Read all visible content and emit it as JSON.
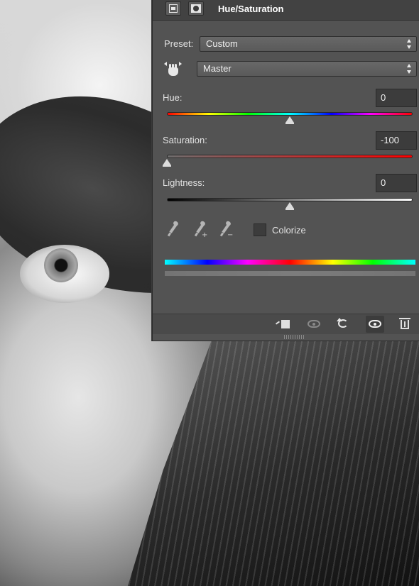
{
  "panel": {
    "title": "Hue/Saturation",
    "header_icons": [
      "adjustment-layer-icon",
      "layer-mask-icon"
    ]
  },
  "preset": {
    "label": "Preset:",
    "value": "Custom"
  },
  "channel": {
    "value": "Master"
  },
  "hue": {
    "label": "Hue:",
    "value": "0",
    "slider_fraction": 0.5
  },
  "saturation": {
    "label": "Saturation:",
    "value": "-100",
    "slider_fraction": 0.0
  },
  "lightness": {
    "label": "Lightness:",
    "value": "0",
    "slider_fraction": 0.5
  },
  "colorize": {
    "label": "Colorize",
    "checked": false
  },
  "tools": [
    "eyedropper-icon",
    "eyedropper-plus-icon",
    "eyedropper-minus-icon"
  ],
  "footer_icons": [
    "clip-to-layer-icon",
    "view-previous-state-icon",
    "reset-icon",
    "toggle-visibility-icon",
    "delete-icon"
  ],
  "colors": {
    "panel_bg": "#535353",
    "header_bg": "#424242",
    "field_bg": "#3c3c3c",
    "text": "#e2e2e2"
  }
}
